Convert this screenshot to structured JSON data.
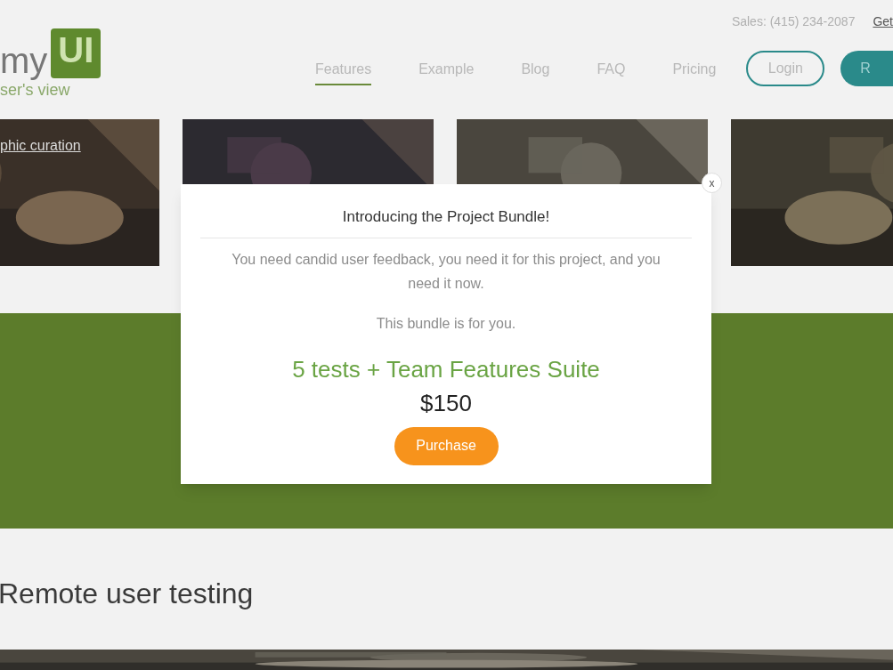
{
  "header": {
    "sales": "Sales: (415) 234-2087",
    "top_link": "Get",
    "logo": {
      "word": "my",
      "badge": "UI",
      "tagline": "ser's view"
    },
    "nav": [
      {
        "label": "Features",
        "selected": true
      },
      {
        "label": "Example",
        "selected": false
      },
      {
        "label": "Blog",
        "selected": false
      },
      {
        "label": "FAQ",
        "selected": false
      },
      {
        "label": "Pricing",
        "selected": false
      }
    ],
    "login": "Login",
    "signup": "R"
  },
  "cards": [
    {
      "kind": "picture",
      "link": "phic curation"
    },
    {
      "kind": "picture"
    },
    {
      "kind": "picture"
    },
    {
      "kind": "picture"
    }
  ],
  "section_title": "Remote user testing",
  "modal": {
    "close": "x",
    "title": "Introducing the Project Bundle!",
    "text": "You need candid user feedback, you need it for this project, and you need it now.",
    "subtext": "This bundle is for you.",
    "offer": "5 tests + Team Features Suite",
    "price": "$150",
    "button": "Purchase"
  }
}
